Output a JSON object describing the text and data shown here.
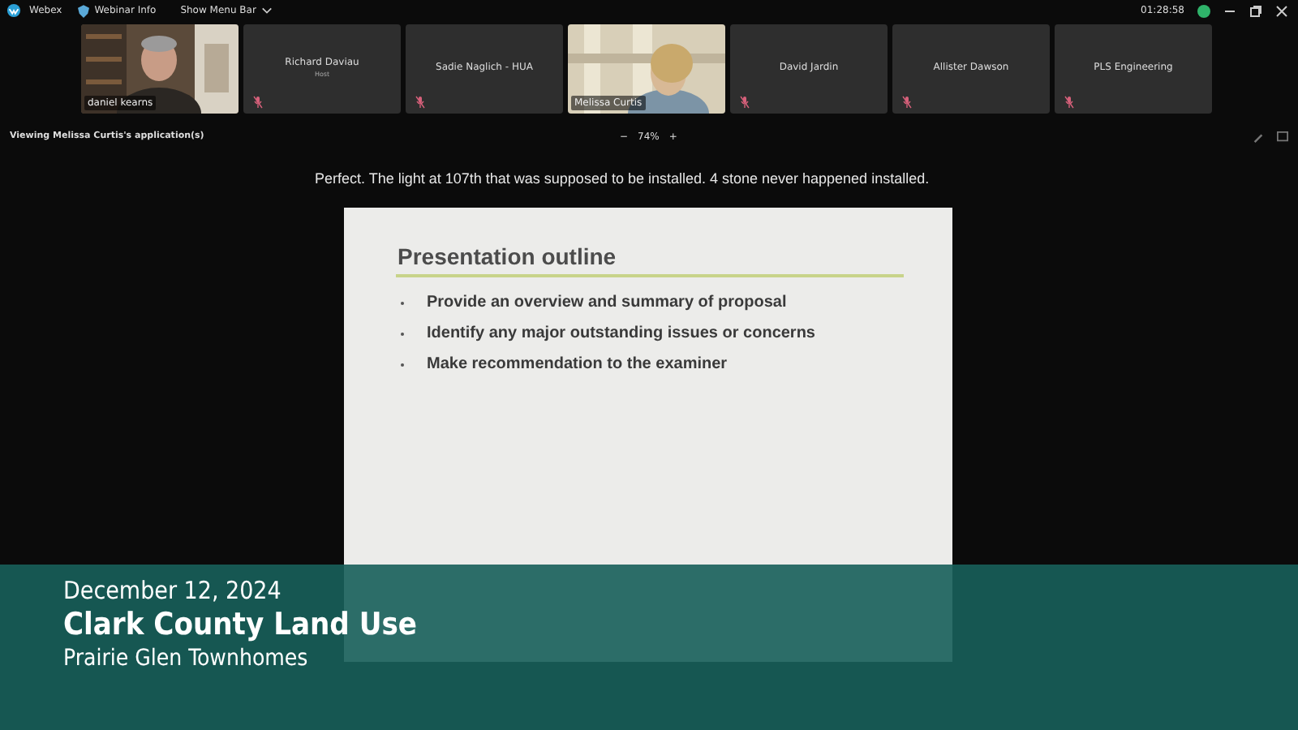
{
  "title_bar": {
    "app": "Webex",
    "menus": [
      "Webinar Info",
      "Show Menu Bar"
    ],
    "clock": "01:28:58"
  },
  "participants": [
    {
      "kind": "video",
      "name": "daniel kearns",
      "muted": false
    },
    {
      "kind": "name",
      "name": "Richard Daviau",
      "role": "Host",
      "muted": true
    },
    {
      "kind": "name",
      "name": "Sadie Naglich - HUA",
      "muted": true
    },
    {
      "kind": "video",
      "name": "Melissa Curtis",
      "muted": false
    },
    {
      "kind": "name",
      "name": "David Jardin",
      "muted": true
    },
    {
      "kind": "name",
      "name": "Allister Dawson",
      "muted": true
    },
    {
      "kind": "name",
      "name": "PLS Engineering",
      "muted": true
    }
  ],
  "share_bar": {
    "label": "Viewing Melissa Curtis's application(s)",
    "zoom": "74%",
    "zoom_out": "−",
    "zoom_in": "+"
  },
  "caption": "Perfect. The light at 107th that was supposed to be installed. 4 stone never happened installed.",
  "slide": {
    "title": "Presentation outline",
    "bullets": [
      "Provide an overview and summary of proposal",
      "Identify any major outstanding issues or concerns",
      "Make recommendation to the examiner"
    ]
  },
  "lower_third": {
    "date": "December 12, 2024",
    "title": "Clark County Land Use",
    "subtitle": "Prairie Glen Townhomes"
  }
}
